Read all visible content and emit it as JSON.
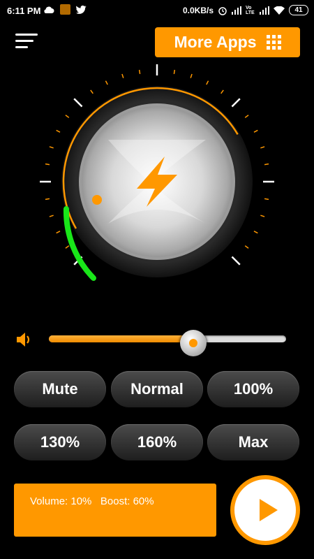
{
  "status_bar": {
    "time": "6:11 PM",
    "net_speed": "0.0KB/s",
    "battery": "41",
    "lte_label": "Vo LTE",
    "icons": [
      "cloud-icon",
      "app-notification-icon",
      "twitter-icon",
      "alarm-icon",
      "signal-icon",
      "volte-icon",
      "signal-icon",
      "wifi-icon",
      "battery-icon"
    ]
  },
  "header": {
    "menu_icon": "menu-icon",
    "more_apps_label": "More Apps",
    "more_apps_icon": "grid-icon"
  },
  "knob": {
    "center_icon": "lightning-bolt-icon",
    "green_level": 0.1,
    "orange_level": 0.6
  },
  "volume_slider": {
    "icon": "speaker-icon",
    "value_percent": 61
  },
  "presets": [
    "Mute",
    "Normal",
    "100%",
    "130%",
    "160%",
    "Max"
  ],
  "info": {
    "text": "Volume: 10%   Boost: 60%"
  },
  "play_button": {
    "icon": "play-icon"
  },
  "colors": {
    "accent": "#ff9800",
    "green": "#19e619",
    "background": "#000000"
  }
}
